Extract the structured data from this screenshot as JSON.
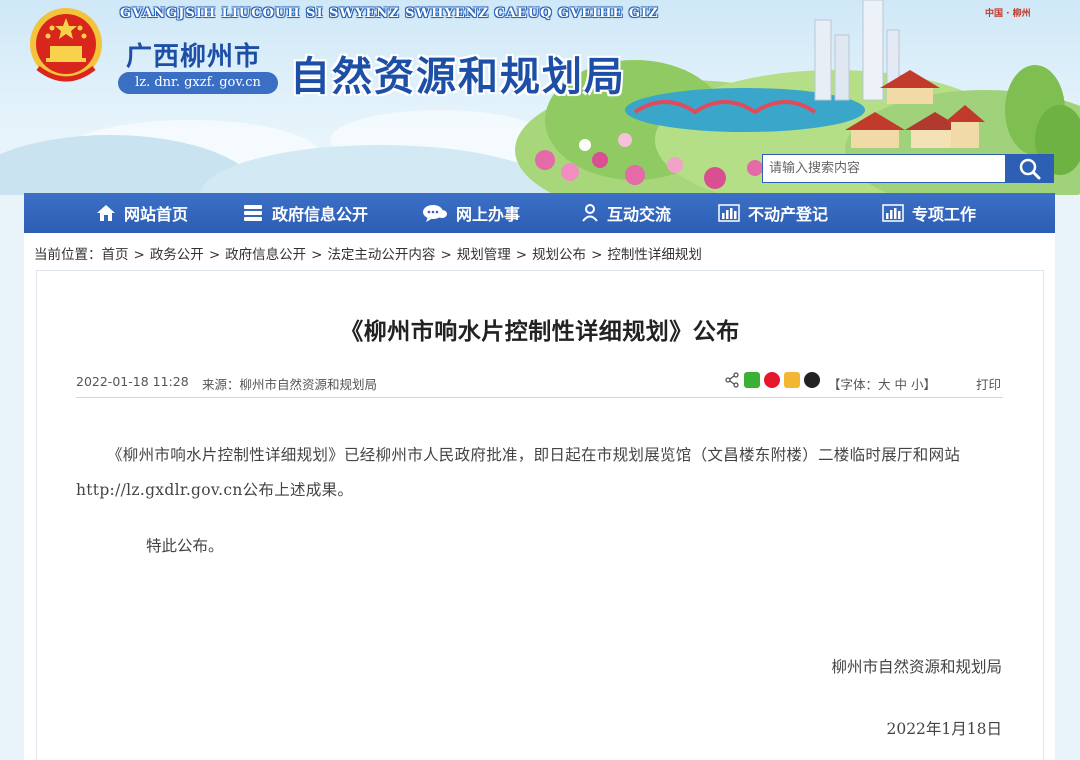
{
  "header": {
    "zhuang_line": "GVANGJSIH LIUCOUH SI SWYENZ SWHYENZ CAEUQ GVEIHE GIZ",
    "city_name": "广西柳州市",
    "domain": "lz. dnr. gxzf. gov.cn",
    "bureau_name": "自然资源和规划局",
    "corner_tag": "中国 · 柳州"
  },
  "search": {
    "placeholder": "请输入搜索内容"
  },
  "nav": {
    "items": [
      {
        "label": "网站首页",
        "icon": "home-icon"
      },
      {
        "label": "政府信息公开",
        "icon": "document-stack-icon"
      },
      {
        "label": "网上办事",
        "icon": "chat-bubble-icon"
      },
      {
        "label": "互动交流",
        "icon": "person-icon"
      },
      {
        "label": "不动产登记",
        "icon": "bar-chart-icon"
      },
      {
        "label": "专项工作",
        "icon": "bar-chart-icon"
      }
    ]
  },
  "breadcrumb": {
    "prefix": "当前位置：",
    "items": [
      "首页",
      "政务公开",
      "政府信息公开",
      "法定主动公开内容",
      "规划管理",
      "规划公布",
      "控制性详细规划"
    ]
  },
  "article": {
    "title": "《柳州市响水片控制性详细规划》公布",
    "date": "2022-01-18 11:28",
    "source": "来源：柳州市自然资源和规划局",
    "font_size_label_open": "【字体：",
    "font_size_large": "大",
    "font_size_medium": "中",
    "font_size_small": "小",
    "font_size_label_close": "】",
    "print": "打印",
    "paragraph": "《柳州市响水片控制性详细规划》已经柳州市人民政府批准，即日起在市规划展览馆（文昌楼东附楼）二楼临时展厅和网站http://lz.gxdlr.gov.cn公布上述成果。",
    "closing": "特此公布。",
    "signature": "柳州市自然资源和规划局",
    "sign_date": "2022年1月18日"
  },
  "colors": {
    "nav_bg": "#2c5eb3",
    "title_blue": "#1d4fa6"
  }
}
